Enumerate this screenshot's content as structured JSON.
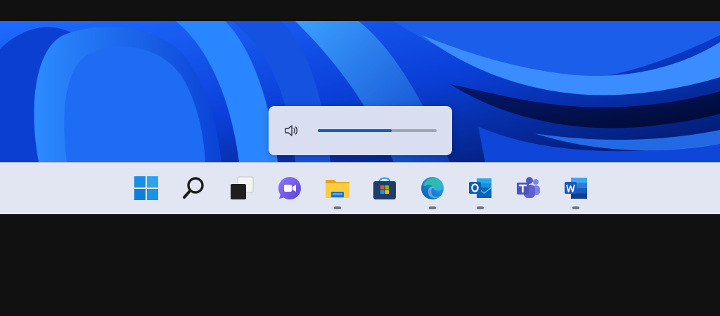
{
  "volume_flyout": {
    "level": 0.62,
    "icon": "speaker-icon",
    "accent": "#0f5fc0"
  },
  "taskbar": {
    "items": [
      {
        "name": "start",
        "icon": "windows-logo-icon",
        "running": false
      },
      {
        "name": "search",
        "icon": "search-icon",
        "running": false
      },
      {
        "name": "task-view",
        "icon": "task-view-icon",
        "running": false
      },
      {
        "name": "chat",
        "icon": "chat-icon",
        "running": false
      },
      {
        "name": "file-explorer",
        "icon": "folder-icon",
        "running": true
      },
      {
        "name": "microsoft-store",
        "icon": "store-icon",
        "running": false
      },
      {
        "name": "edge",
        "icon": "edge-icon",
        "running": true
      },
      {
        "name": "outlook",
        "icon": "outlook-icon",
        "running": true
      },
      {
        "name": "teams",
        "icon": "teams-icon",
        "running": false
      },
      {
        "name": "word",
        "icon": "word-icon",
        "running": true
      }
    ]
  }
}
